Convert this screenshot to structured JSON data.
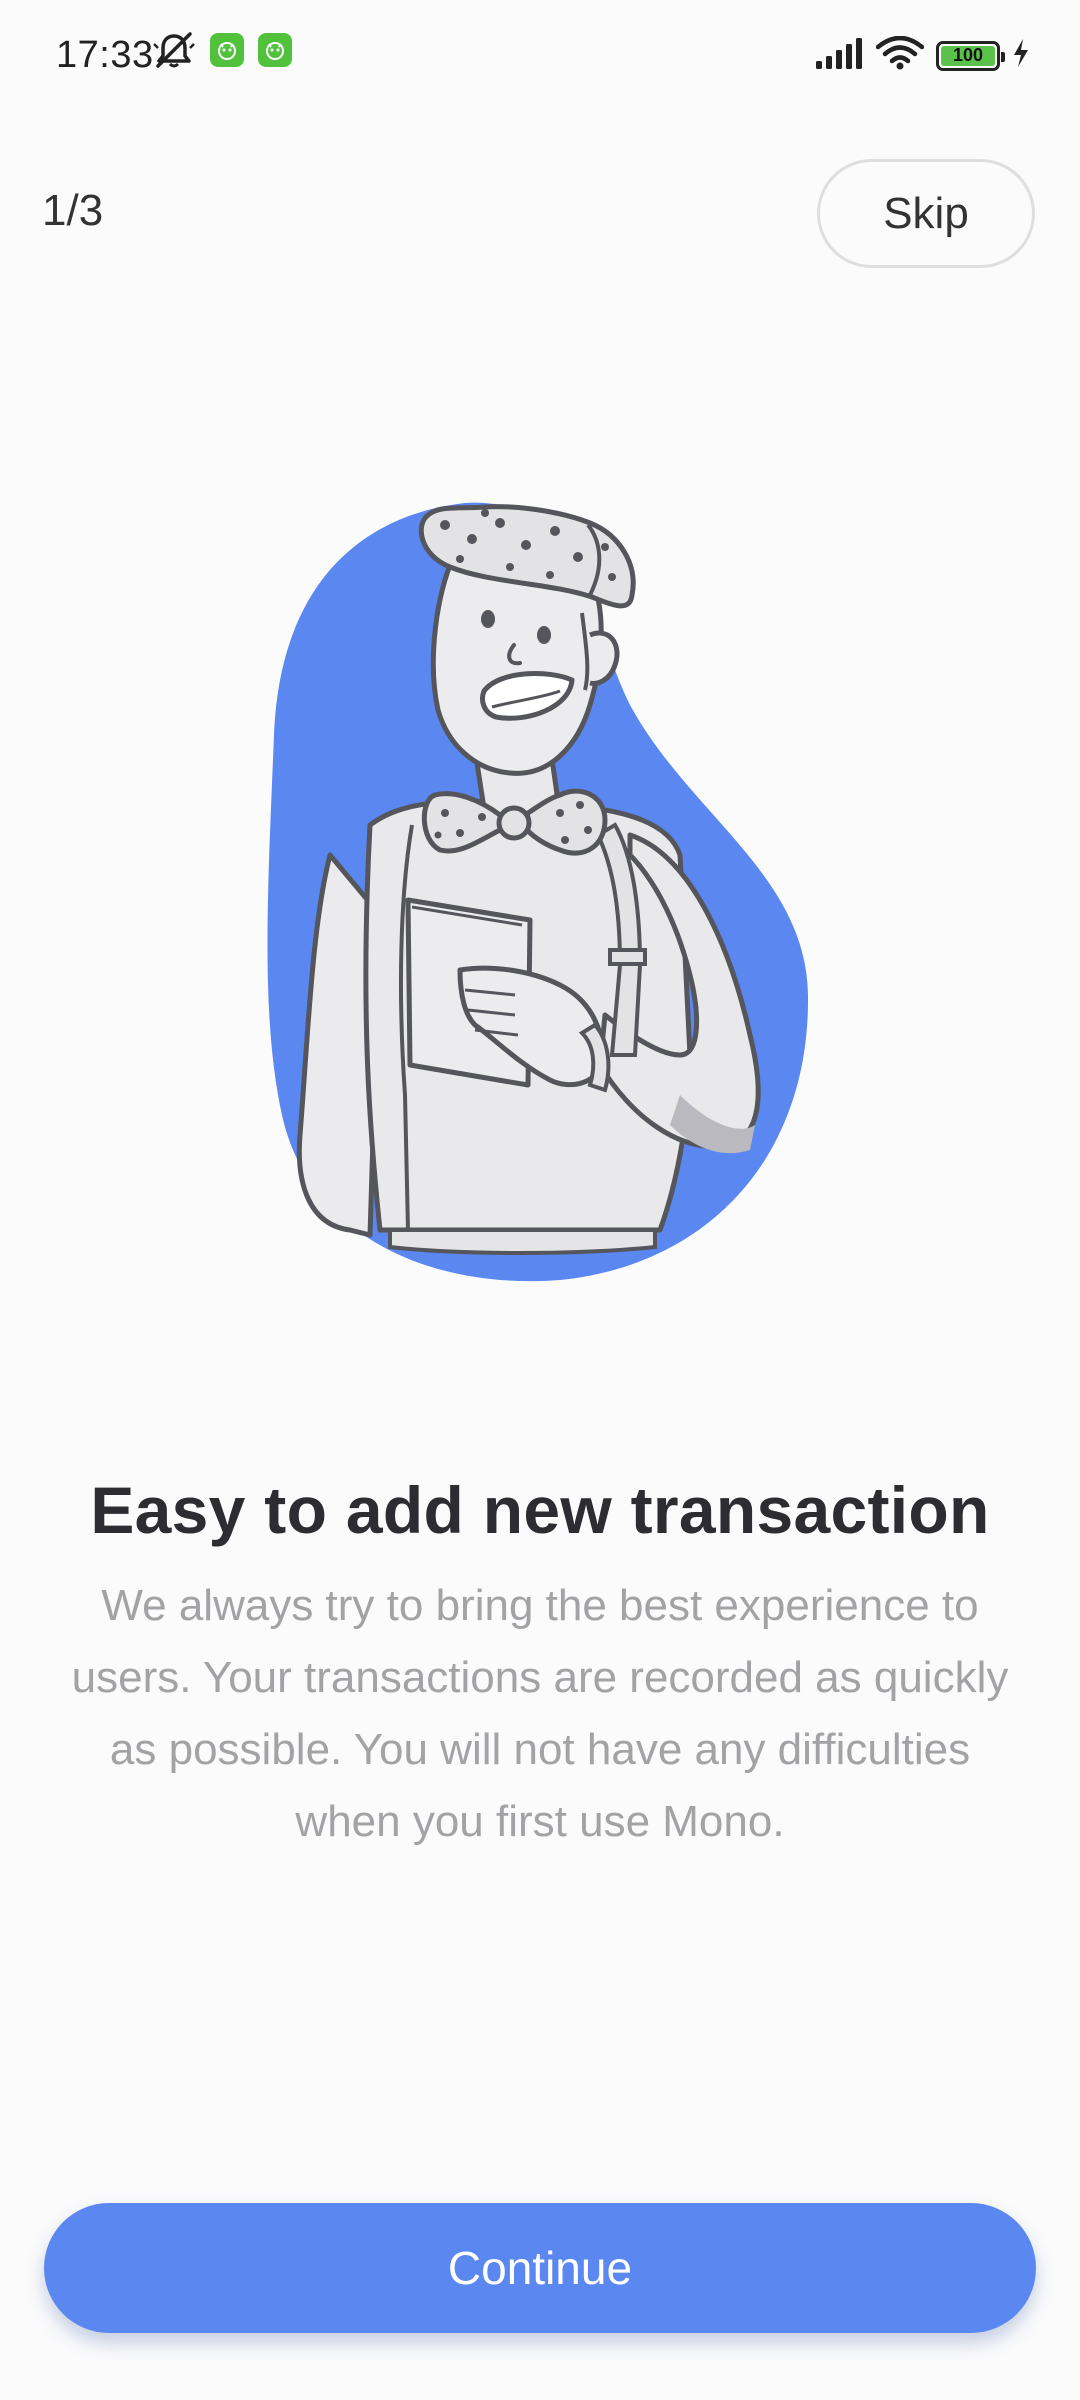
{
  "status_bar": {
    "time": "17:33",
    "battery_level": "100",
    "icons": [
      "mute-bell-icon",
      "app-notification-icon",
      "app-notification-icon",
      "signal-icon",
      "wifi-icon",
      "battery-icon",
      "charging-bolt-icon"
    ]
  },
  "onboarding": {
    "page_counter": "1/3",
    "skip_label": "Skip",
    "headline": "Easy to add new transaction",
    "description": "We always try to bring the best experience to users. Your transactions are recorded as quickly as possible. You will not have any difficulties when you first use Mono.",
    "continue_label": "Continue"
  },
  "colors": {
    "accent": "#5b87f1",
    "blob": "#5b87f1",
    "background": "#fbfbfc",
    "headline": "#2d2d31",
    "description": "#a3a3a6"
  }
}
